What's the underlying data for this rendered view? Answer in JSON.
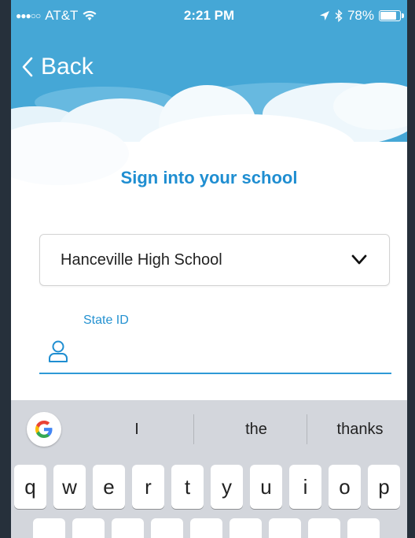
{
  "status_bar": {
    "carrier": "AT&T",
    "time": "2:21 PM",
    "battery_percent": "78%",
    "battery_level": 0.78
  },
  "nav": {
    "back_label": "Back"
  },
  "form": {
    "title": "Sign into your school",
    "school_value": "Hanceville High School",
    "state_id_label": "State ID",
    "state_id_value": ""
  },
  "keyboard": {
    "suggestions": [
      "I",
      "the",
      "thanks"
    ],
    "row1": [
      "q",
      "w",
      "e",
      "r",
      "t",
      "y",
      "u",
      "i",
      "o",
      "p"
    ]
  },
  "colors": {
    "header_blue": "#45a7d6",
    "accent_blue": "#1f8ed1",
    "input_line": "#2f9ad6",
    "keyboard_bg": "#d3d6dc"
  }
}
